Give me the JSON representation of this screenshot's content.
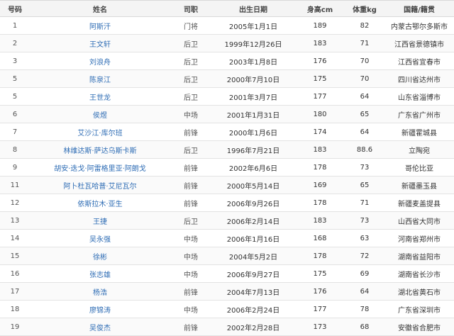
{
  "table": {
    "headers": [
      "号码",
      "姓名",
      "司职",
      "出生日期",
      "身高cm",
      "体重kg",
      "国籍/籍贯"
    ],
    "rows": [
      [
        "1",
        "阿斯汗",
        "门将",
        "2005年1月1日",
        "189",
        "82",
        "内蒙古鄂尔多斯市"
      ],
      [
        "2",
        "王文轩",
        "后卫",
        "1999年12月26日",
        "183",
        "71",
        "江西省景德镇市"
      ],
      [
        "3",
        "刘浪舟",
        "后卫",
        "2003年1月8日",
        "176",
        "70",
        "江西省宜春市"
      ],
      [
        "5",
        "陈泉江",
        "后卫",
        "2000年7月10日",
        "175",
        "70",
        "四川省达州市"
      ],
      [
        "5",
        "王世龙",
        "后卫",
        "2001年3月7日",
        "177",
        "64",
        "山东省淄博市"
      ],
      [
        "6",
        "侯煜",
        "中场",
        "2001年1月31日",
        "180",
        "65",
        "广东省广州市"
      ],
      [
        "7",
        "艾沙江·库尔班",
        "前锋",
        "2000年1月6日",
        "174",
        "64",
        "新疆霍城县"
      ],
      [
        "8",
        "林维达斯·萨达乌斯卡斯",
        "后卫",
        "1996年7月21日",
        "183",
        "88.6",
        "立陶宛"
      ],
      [
        "9",
        "胡安·迭戈·阿雷格里亚·阿朗戈",
        "前锋",
        "2002年6月6日",
        "178",
        "73",
        "哥伦比亚"
      ],
      [
        "11",
        "阿卜杜瓦哈普·艾尼瓦尔",
        "前锋",
        "2000年5月14日",
        "169",
        "65",
        "新疆墨玉县"
      ],
      [
        "12",
        "依斯拉木·亚生",
        "前锋",
        "2006年9月26日",
        "178",
        "71",
        "新疆麦盖提县"
      ],
      [
        "13",
        "王捷",
        "后卫",
        "2006年2月14日",
        "183",
        "73",
        "山西省大同市"
      ],
      [
        "14",
        "吴永强",
        "中场",
        "2006年1月16日",
        "168",
        "63",
        "河南省郑州市"
      ],
      [
        "15",
        "徐彬",
        "中场",
        "2004年5月2日",
        "178",
        "72",
        "湖南省益阳市"
      ],
      [
        "16",
        "张志雄",
        "中场",
        "2006年9月27日",
        "175",
        "69",
        "湖南省长沙市"
      ],
      [
        "17",
        "杨浩",
        "前锋",
        "2004年7月13日",
        "176",
        "64",
        "湖北省黄石市"
      ],
      [
        "18",
        "廖锦涛",
        "中场",
        "2006年2月24日",
        "177",
        "78",
        "广东省深圳市"
      ],
      [
        "19",
        "吴俊杰",
        "前锋",
        "2002年2月28日",
        "173",
        "68",
        "安徽省合肥市"
      ]
    ]
  }
}
